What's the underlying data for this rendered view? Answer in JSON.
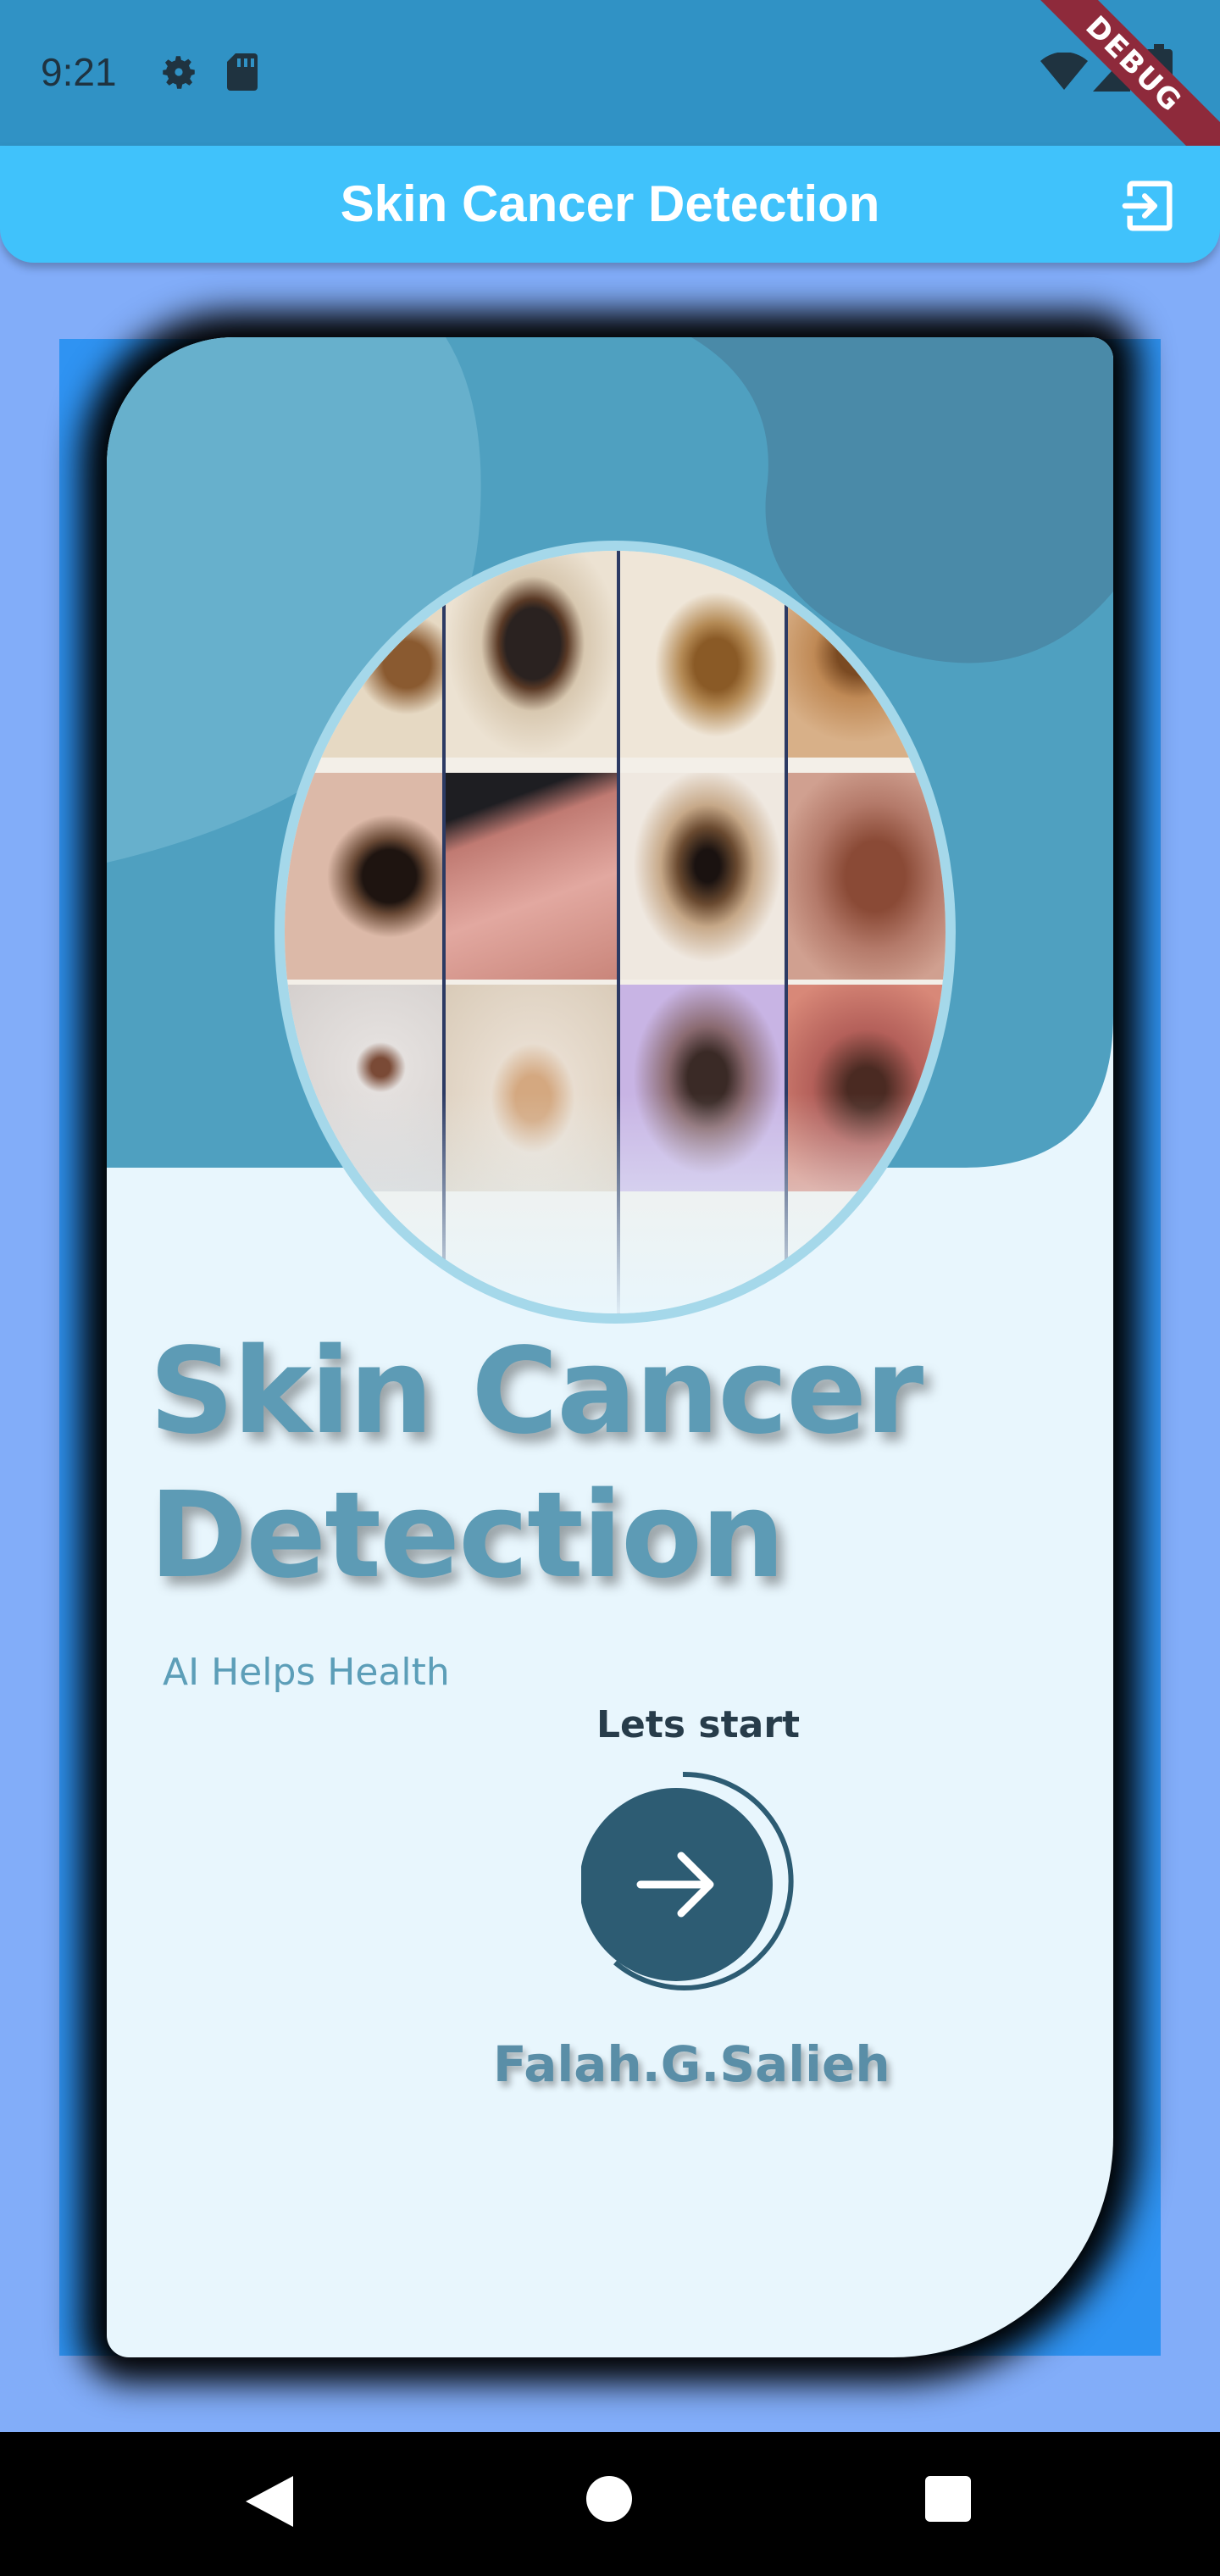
{
  "status_bar": {
    "time": "9:21",
    "icons": [
      "gear-icon",
      "sd-card-icon",
      "wifi-icon",
      "signal-icon",
      "battery-icon"
    ],
    "debug_banner": "DEBUG"
  },
  "app_bar": {
    "title": "Skin Cancer Detection",
    "action_icon": "logout-icon"
  },
  "card": {
    "title": "Skin Cancer Detection",
    "tagline": "AI Helps Health",
    "cta_label": "Lets start",
    "cta_icon": "arrow-right-icon",
    "author": "Falah.G.Salieh",
    "gallery_image": "skin-lesion-grid"
  },
  "nav_bar": {
    "back": "back-triangle-icon",
    "home": "home-circle-icon",
    "recents": "recents-square-icon"
  },
  "colors": {
    "status_bar": "#3092c5",
    "app_bar": "#40c2fb",
    "background": "#82adf9",
    "card": "#e8f6fd",
    "hero": "#4fa0c0",
    "button": "#2d5c73"
  }
}
